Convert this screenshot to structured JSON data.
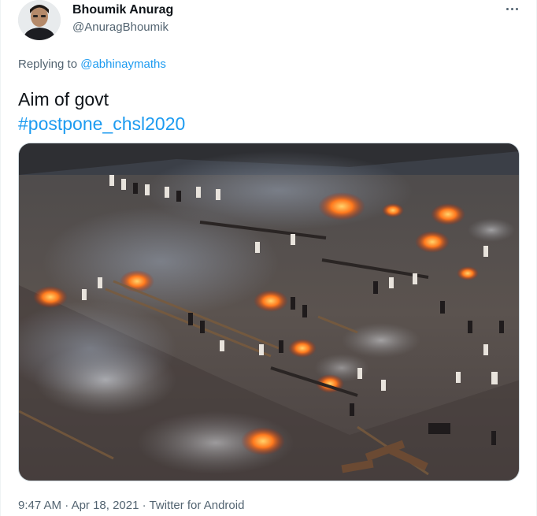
{
  "author": {
    "name": "Bhoumik Anurag",
    "handle": "@AnuragBhoumik"
  },
  "reply": {
    "prefix": "Replying to ",
    "target": "@abhinaymaths"
  },
  "tweet": {
    "line1": "Aim of govt",
    "hashtag": "#postpone_chsl2020"
  },
  "meta": {
    "time": "9:47 AM",
    "sep1": " · ",
    "date": "Apr 18, 2021",
    "sep2": " · ",
    "source": "Twitter for Android"
  },
  "colors": {
    "accent": "#1d9bf0",
    "text": "#0f1419",
    "secondary": "#536471"
  },
  "icons": {
    "more": "more-dots-icon"
  }
}
